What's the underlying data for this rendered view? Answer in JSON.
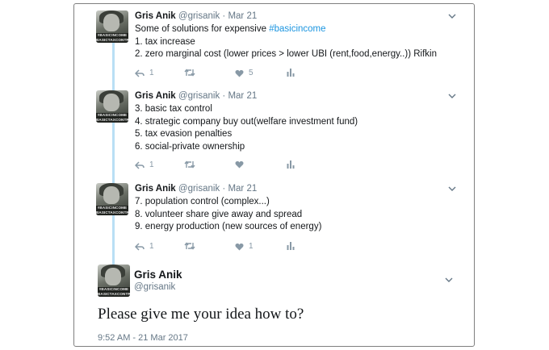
{
  "tweets": [
    {
      "name": "Gris Anik",
      "handle": "@grisanik",
      "date": "Mar 21",
      "lines": [
        {
          "pre": "Some of solutions for expensive ",
          "hashtag": "#basicincome"
        },
        {
          "pre": "1. tax increase"
        },
        {
          "pre": "2. zero marginal cost (lower prices > lower UBI (rent,food,energy..)) Rifkin"
        }
      ],
      "reply_count": "1",
      "retweet_count": "",
      "like_count": "5"
    },
    {
      "name": "Gris Anik",
      "handle": "@grisanik",
      "date": "Mar 21",
      "lines": [
        {
          "pre": "3. basic tax control"
        },
        {
          "pre": "4. strategic company buy out(welfare investment fund)"
        },
        {
          "pre": "5. tax evasion penalties"
        },
        {
          "pre": "6. social-private ownership"
        }
      ],
      "reply_count": "1",
      "retweet_count": "",
      "like_count": ""
    },
    {
      "name": "Gris Anik",
      "handle": "@grisanik",
      "date": "Mar 21",
      "lines": [
        {
          "pre": "7. population control (complex...)"
        },
        {
          "pre": "8. volunteer share give away and spread"
        },
        {
          "pre": "9. energy production (new sources of energy)"
        }
      ],
      "reply_count": "1",
      "retweet_count": "",
      "like_count": "1"
    }
  ],
  "avatar_tag": "#BASICINCOME BASICTAXCONTROL",
  "main_tweet": {
    "name": "Gris Anik",
    "handle": "@grisanik",
    "text": "Please give me your idea how to?",
    "timestamp": "9:52 AM - 21 Mar 2017"
  },
  "icons": {
    "reply": "reply-icon",
    "retweet": "retweet-icon",
    "like": "heart-icon",
    "analytics": "analytics-icon",
    "menu": "chevron-down-icon"
  },
  "colors": {
    "thread_line": "#b9dff5",
    "hashtag": "#1b95e0",
    "muted": "#657786"
  }
}
